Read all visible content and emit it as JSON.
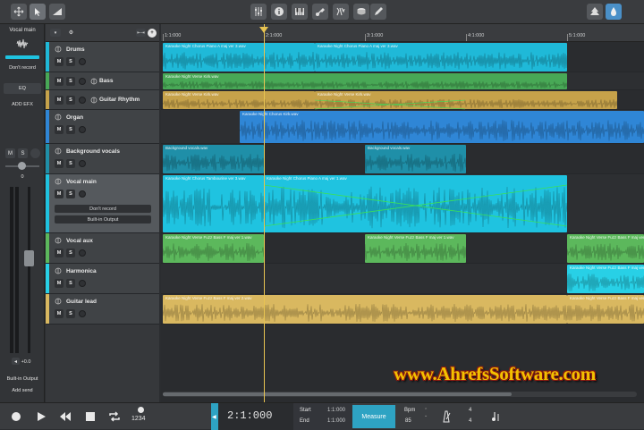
{
  "colors": {
    "accent": "#1fc3e0",
    "playhead": "#e8c452",
    "drums": "#1fb9d8",
    "bass": "#48a856",
    "guitar_rhythm": "#c6a24a",
    "organ": "#2f86d6",
    "background_vocals": "#1f8fa8",
    "vocal_main": "#1fc3e0",
    "vocal_aux": "#5cb85c",
    "harmonica": "#28d0e6",
    "guitar_lead": "#d9b860"
  },
  "toolbar": {
    "left_icons": [
      "move-icon",
      "pointer-icon",
      "automation-icon"
    ],
    "center_icons": [
      "mixer-icon",
      "info-icon",
      "keyboard-icon",
      "instrument-icon",
      "fx-icon",
      "drum-icon",
      "pen-icon"
    ],
    "right_icons": [
      "tree-icon",
      "settings-icon"
    ]
  },
  "inspector": {
    "title": "Vocal main",
    "record_label": "Don't record",
    "eq_label": "EQ",
    "add_fx_label": "ADD EFX",
    "mute": "M",
    "solo": "S",
    "pan_value": "0",
    "volume_value": "+0.0",
    "output_label": "Built-in Output",
    "add_send_label": "Add send"
  },
  "ruler": {
    "labels": [
      "1:1:000",
      "2:1:000",
      "3:1:000",
      "4:1:000",
      "5:1:000"
    ]
  },
  "tracks": [
    {
      "name": "Drums",
      "color": "#1fb9d8"
    },
    {
      "name": "Bass",
      "color": "#48a856"
    },
    {
      "name": "Guitar Rhythm",
      "color": "#c6a24a"
    },
    {
      "name": "Organ",
      "color": "#2f86d6"
    },
    {
      "name": "Background vocals",
      "color": "#1f8fa8"
    },
    {
      "name": "Vocal main",
      "color": "#1fc3e0",
      "record": "Don't record",
      "output": "Built-in Output"
    },
    {
      "name": "Vocal aux",
      "color": "#5cb85c"
    },
    {
      "name": "Harmonica",
      "color": "#28d0e6"
    },
    {
      "name": "Guitar lead",
      "color": "#d9b860"
    }
  ],
  "clips": {
    "drums_1": "Karaoke Night Chorus Piano A maj ver 3.wav",
    "drums_2": "Karaoke Night Chorus Piano A maj ver 3.wav",
    "bass_1": "Karaoke Night Verse Kirk.wav",
    "guitar_1": "Karaoke Night Verse Kirk.wav",
    "guitar_2": "Karaoke Night Verse Kirk.wav",
    "organ_1": "Karaoke Night Chorus Kirk.wav",
    "bgv_1": "Background vocals.wav",
    "bgv_2": "Background vocals.wav",
    "vocal_1": "Karaoke Night Chorus Tambourine ver 3.wav",
    "vocal_2": "Karaoke Night Chorus Piano A maj ver 1.wav",
    "aux_1": "Karaoke Night Verse Fuzz Bass F maj ver 1.wav",
    "aux_2": "Karaoke Night Verse Fuzz Bass F maj ver 1.wav",
    "aux_3": "Karaoke Night Verse Fuzz Bass F maj ver 1.wav",
    "harm_1": "Karaoke Night Verse Fuzz Bass F maj ver 1.wav",
    "lead_1": "Karaoke Night Verse Fuzz Bass F maj ver 2.wav",
    "lead_2": "Karaoke Night Verse Fuzz Bass F maj ver 2.wav"
  },
  "transport": {
    "position": "2:1:000",
    "start_label": "Start",
    "start_value": "1:1:000",
    "end_label": "End",
    "end_value": "1:1:000",
    "measure_label": "Measure",
    "bpm_label": "Bpm",
    "bpm_value": "85",
    "sig_top": "4",
    "sig_bottom": "4",
    "count_in": "1234"
  },
  "watermark": "www.AhrefsSoftware.com"
}
